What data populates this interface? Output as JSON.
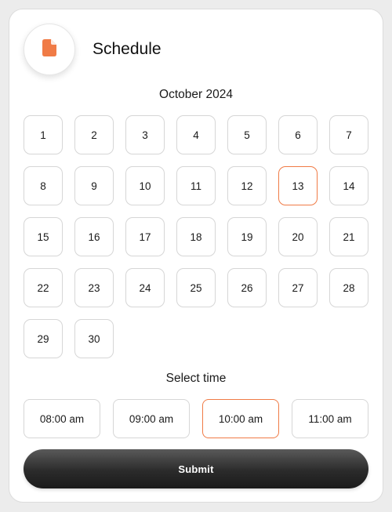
{
  "header": {
    "title": "Schedule",
    "icon": "document-icon",
    "icon_color": "#f07b46"
  },
  "calendar": {
    "month_label": "October 2024",
    "days": [
      "1",
      "2",
      "3",
      "4",
      "5",
      "6",
      "7",
      "8",
      "9",
      "10",
      "11",
      "12",
      "13",
      "14",
      "15",
      "16",
      "17",
      "18",
      "19",
      "20",
      "21",
      "22",
      "23",
      "24",
      "25",
      "26",
      "27",
      "28",
      "29",
      "30"
    ],
    "selected_day": "13"
  },
  "time_section": {
    "label": "Select time",
    "slots": [
      "08:00 am",
      "09:00 am",
      "10:00 am",
      "11:00 am"
    ],
    "selected_slot": "10:00 am"
  },
  "actions": {
    "submit_label": "Submit"
  },
  "colors": {
    "accent": "#f07b46",
    "button_dark": "#2b2b2b"
  }
}
